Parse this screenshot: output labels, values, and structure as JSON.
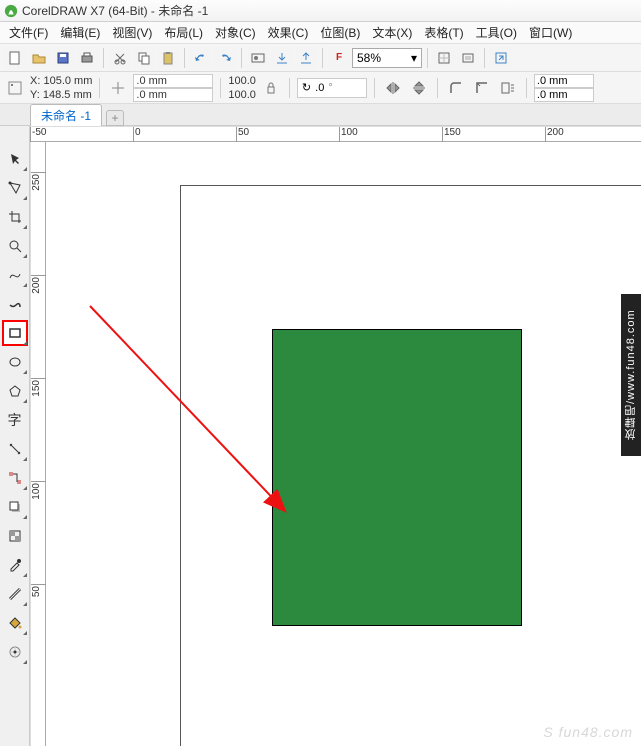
{
  "title": "CorelDRAW X7 (64-Bit) - 未命名 -1",
  "menu": [
    "文件(F)",
    "编辑(E)",
    "视图(V)",
    "布局(L)",
    "对象(C)",
    "效果(C)",
    "位图(B)",
    "文本(X)",
    "表格(T)",
    "工具(O)",
    "窗口(W)"
  ],
  "zoom": "58%",
  "xlabel": "X:",
  "ylabel": "Y:",
  "x": "105.0 mm",
  "y": "148.5 mm",
  "w": ".0 mm",
  "h": ".0 mm",
  "sx": "100.0",
  "sy": "100.0",
  "rotate": ".0",
  "outline1": ".0 mm",
  "outline2": ".0 mm",
  "tabname": "未命名 -1",
  "ruler_h": [
    "-50",
    "0",
    "50",
    "100",
    "150",
    "200"
  ],
  "ruler_v": [
    "250",
    "200",
    "150",
    "100",
    "50"
  ],
  "watermark": "放肆吧/www.fun48.com",
  "cornerwm": "S fun48.com",
  "toolnames": [
    "pick",
    "shape",
    "crop",
    "zoom",
    "freehand",
    "smear",
    "rectangle",
    "ellipse",
    "polygon",
    "text",
    "dimension",
    "connector",
    "dropshadow",
    "transparency",
    "eyedropper",
    "outline",
    "fill",
    "interactive-fill"
  ],
  "chart_data": {
    "type": "shape",
    "shape": "rectangle",
    "fill": "#2b8a3e",
    "stroke": "#000000",
    "approx_bbox_mm": {
      "x": 60,
      "y": 40,
      "w": 120,
      "h": 145
    }
  }
}
